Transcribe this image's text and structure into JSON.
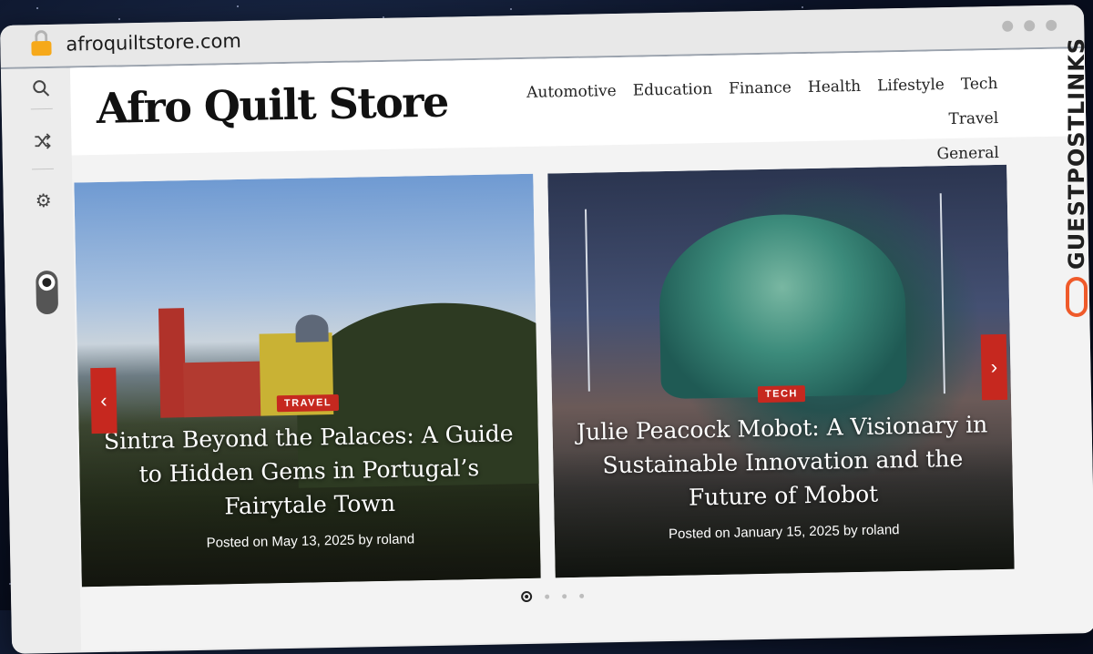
{
  "browser": {
    "url": "afroquiltstore.com"
  },
  "site": {
    "title": "Afro Quilt Store",
    "nav": [
      "Automotive",
      "Education",
      "Finance",
      "Health",
      "Lifestyle",
      "Tech",
      "Travel",
      "General"
    ]
  },
  "slides": [
    {
      "tag": "TRAVEL",
      "title": "Sintra Beyond the Palaces: A Guide to Hidden Gems in Portugal’s Fairytale Town",
      "meta": "Posted on May 13, 2025 by roland"
    },
    {
      "tag": "TECH",
      "title": "Julie Peacock Mobot: A Visionary in Sustainable Innovation and the Future of Mobot",
      "meta": "Posted on January 15, 2025 by roland"
    }
  ],
  "pager": {
    "current": 1,
    "total": 4
  },
  "watermark": "GUESTPOSTLINKS",
  "colors": {
    "accent": "#c6281f",
    "lock": "#f6a91a",
    "watermark_logo": "#ef5a2a"
  }
}
